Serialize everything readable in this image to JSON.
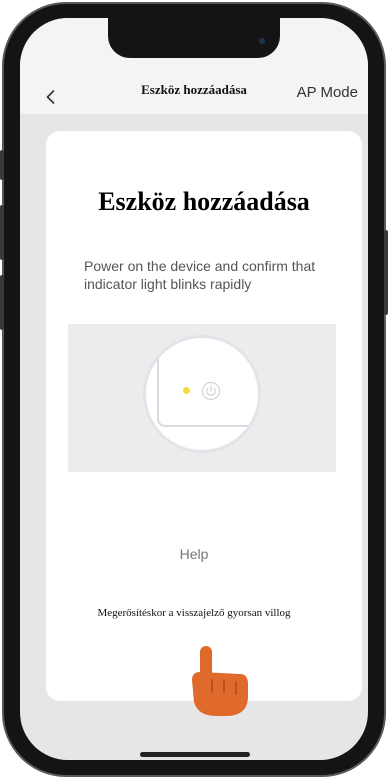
{
  "header": {
    "back_icon": "chevron-left-icon",
    "title": "Eszköz hozzáadása",
    "action_label": "AP Mode"
  },
  "card": {
    "heading": "Eszköz hozzáadása",
    "instruction": "Power on the device and confirm that indicator light blinks rapidly",
    "illustration": {
      "indicator_color": "#f0dc3a",
      "power_icon": "power-icon"
    },
    "help_label": "Help",
    "confirm_label": "Megerősítéskor a visszajelző gyorsan villog"
  },
  "overlay": {
    "pointer_icon": "tap-hand-icon",
    "pointer_color": "#e06a2c"
  },
  "colors": {
    "page_background": "#e6e6e6",
    "card_background": "#ffffff",
    "frame": "#141414"
  }
}
